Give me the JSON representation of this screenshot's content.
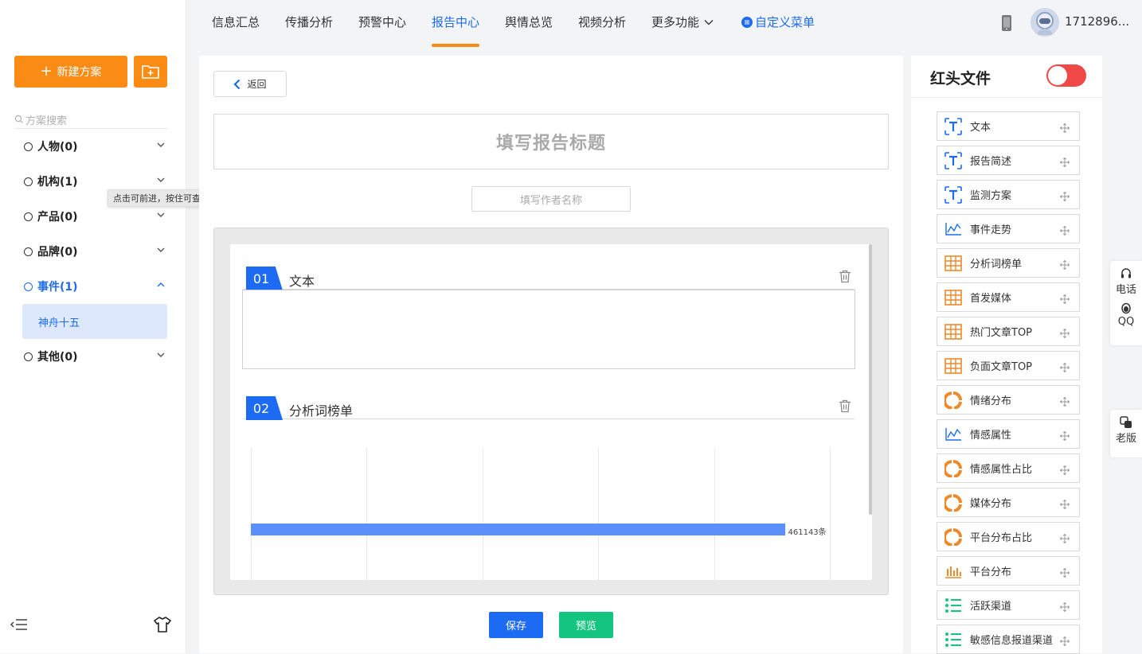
{
  "sidebar": {
    "new_plan_label": "新建方案",
    "search_placeholder": "方案搜索",
    "categories": [
      {
        "label": "人物(0)"
      },
      {
        "label": "机构(1)"
      },
      {
        "label": "产品(0)"
      },
      {
        "label": "品牌(0)"
      },
      {
        "label": "事件(1)",
        "expanded": true
      },
      {
        "label": "其他(0)"
      }
    ],
    "active_subitem": "神舟十五",
    "tooltip": "点击可前进，按住可查看历史记录"
  },
  "nav": {
    "items": [
      "信息汇总",
      "传播分析",
      "预警中心",
      "报告中心",
      "舆情总览",
      "视频分析",
      "更多功能"
    ],
    "active": "报告中心",
    "custom_menu": "自定义菜单",
    "username": "1712896..."
  },
  "editor": {
    "back_label": "返回",
    "title_placeholder": "填写报告标题",
    "author_placeholder": "填写作者名称",
    "blocks": [
      {
        "num": "01",
        "title": "文本"
      },
      {
        "num": "02",
        "title": "分析词榜单"
      }
    ],
    "save_label": "保存",
    "preview_label": "预览"
  },
  "chart_data": {
    "type": "bar",
    "orientation": "horizontal",
    "values": [
      461143
    ],
    "value_labels": [
      "461143条"
    ],
    "xlim": [
      0,
      500000
    ],
    "grid": true
  },
  "components": {
    "title": "红头文件",
    "toggle_on": true,
    "items": [
      {
        "label": "文本",
        "icon": "text-icon"
      },
      {
        "label": "报告简述",
        "icon": "text-icon"
      },
      {
        "label": "监测方案",
        "icon": "text-icon"
      },
      {
        "label": "事件走势",
        "icon": "line-chart-icon"
      },
      {
        "label": "分析词榜单",
        "icon": "table-icon"
      },
      {
        "label": "首发媒体",
        "icon": "table-icon"
      },
      {
        "label": "热门文章TOP",
        "icon": "table-icon"
      },
      {
        "label": "负面文章TOP",
        "icon": "table-icon"
      },
      {
        "label": "情绪分布",
        "icon": "donut-icon"
      },
      {
        "label": "情感属性",
        "icon": "line-chart-icon"
      },
      {
        "label": "情感属性占比",
        "icon": "donut-icon"
      },
      {
        "label": "媒体分布",
        "icon": "donut-icon"
      },
      {
        "label": "平台分布占比",
        "icon": "donut-icon"
      },
      {
        "label": "平台分布",
        "icon": "bar-chart-icon"
      },
      {
        "label": "活跃渠道",
        "icon": "list-icon"
      },
      {
        "label": "敏感信息报道渠道",
        "icon": "list-icon"
      }
    ]
  },
  "float": {
    "phone_label": "电话",
    "qq_label": "QQ",
    "old_label": "老版"
  },
  "colors": {
    "brand_orange": "#fa8c16",
    "primary_blue": "#1d6bf3",
    "success_green": "#14c57f",
    "toggle_red": "#f04747",
    "bar_blue": "#5b8ff9"
  }
}
